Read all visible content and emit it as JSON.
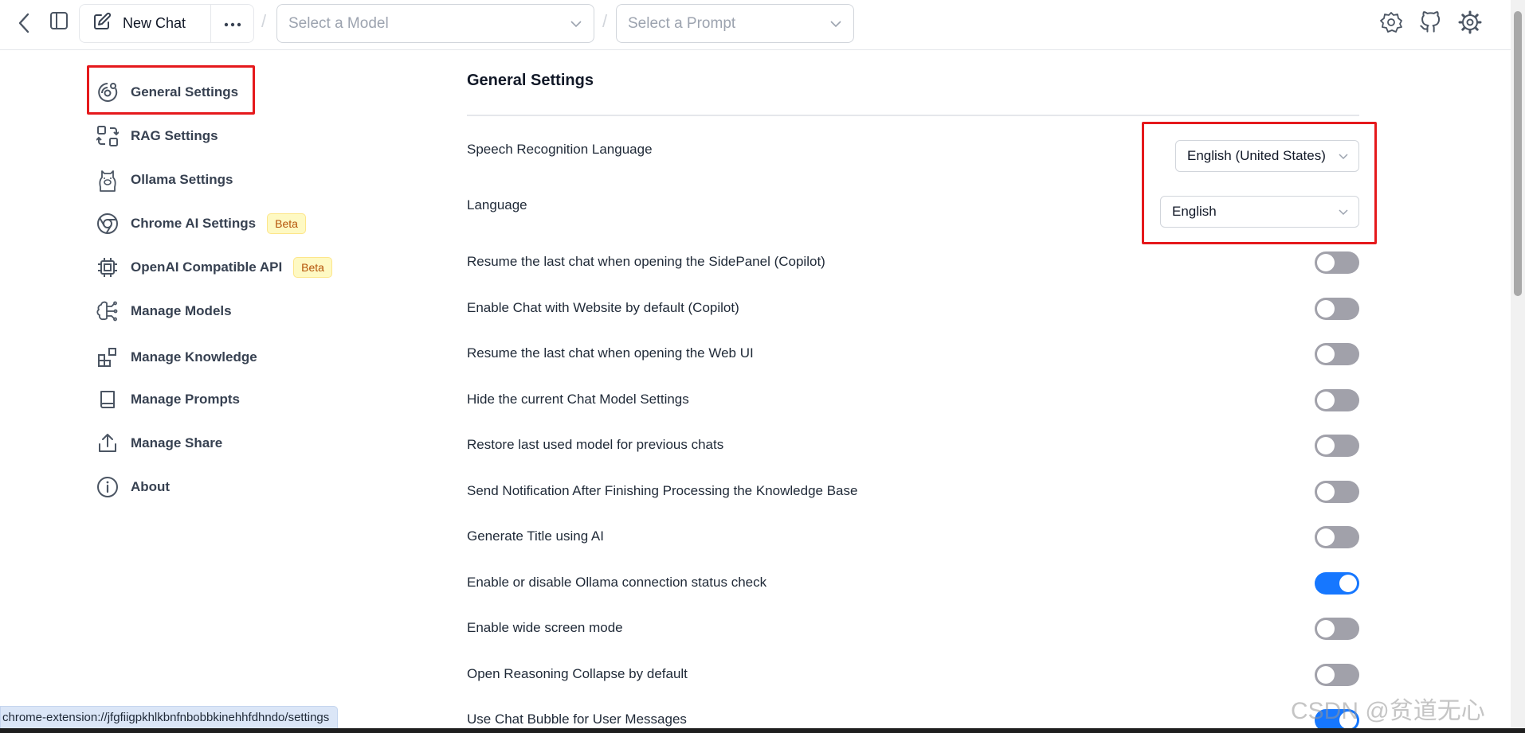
{
  "header": {
    "new_chat_label": "New Chat",
    "model_select_placeholder": "Select a Model",
    "prompt_select_placeholder": "Select a Prompt",
    "separator": "/"
  },
  "sidebar": {
    "items": [
      {
        "label": "General Settings",
        "icon": "general-settings-icon"
      },
      {
        "label": "RAG Settings",
        "icon": "rag-icon"
      },
      {
        "label": "Ollama Settings",
        "icon": "ollama-llama-icon"
      },
      {
        "label": "Chrome AI Settings",
        "icon": "chrome-icon",
        "badge": "Beta"
      },
      {
        "label": "OpenAI Compatible API",
        "icon": "cpu-chip-icon",
        "badge": "Beta"
      },
      {
        "label": "Manage Models",
        "icon": "brain-icon"
      },
      {
        "label": "Manage Knowledge",
        "icon": "blocks-icon"
      },
      {
        "label": "Manage Prompts",
        "icon": "book-icon"
      },
      {
        "label": "Manage Share",
        "icon": "share-upload-icon"
      },
      {
        "label": "About",
        "icon": "info-icon"
      }
    ]
  },
  "main": {
    "title": "General Settings",
    "speech_label": "Speech Recognition Language",
    "speech_value": "English (United States)",
    "language_label": "Language",
    "language_value": "English",
    "toggles": [
      {
        "label": "Resume the last chat when opening the SidePanel (Copilot)",
        "on": false
      },
      {
        "label": "Enable Chat with Website by default (Copilot)",
        "on": false
      },
      {
        "label": "Resume the last chat when opening the Web UI",
        "on": false
      },
      {
        "label": "Hide the current Chat Model Settings",
        "on": false
      },
      {
        "label": "Restore last used model for previous chats",
        "on": false
      },
      {
        "label": "Send Notification After Finishing Processing the Knowledge Base",
        "on": false
      },
      {
        "label": "Generate Title using AI",
        "on": false
      },
      {
        "label": "Enable or disable Ollama connection status check",
        "on": true
      },
      {
        "label": "Enable wide screen mode",
        "on": false
      },
      {
        "label": "Open Reasoning Collapse by default",
        "on": false
      },
      {
        "label": "Use Chat Bubble for User Messages",
        "on": true
      }
    ]
  },
  "status_url": "chrome-extension://jfgfiigpkhlkbnfnbobbkinehhfdhndo/settings",
  "watermark": "CSDN @贫道无心",
  "colors": {
    "accent": "#1677ff",
    "highlight": "#e5191c",
    "toggle_off": "#a1a1aa"
  }
}
